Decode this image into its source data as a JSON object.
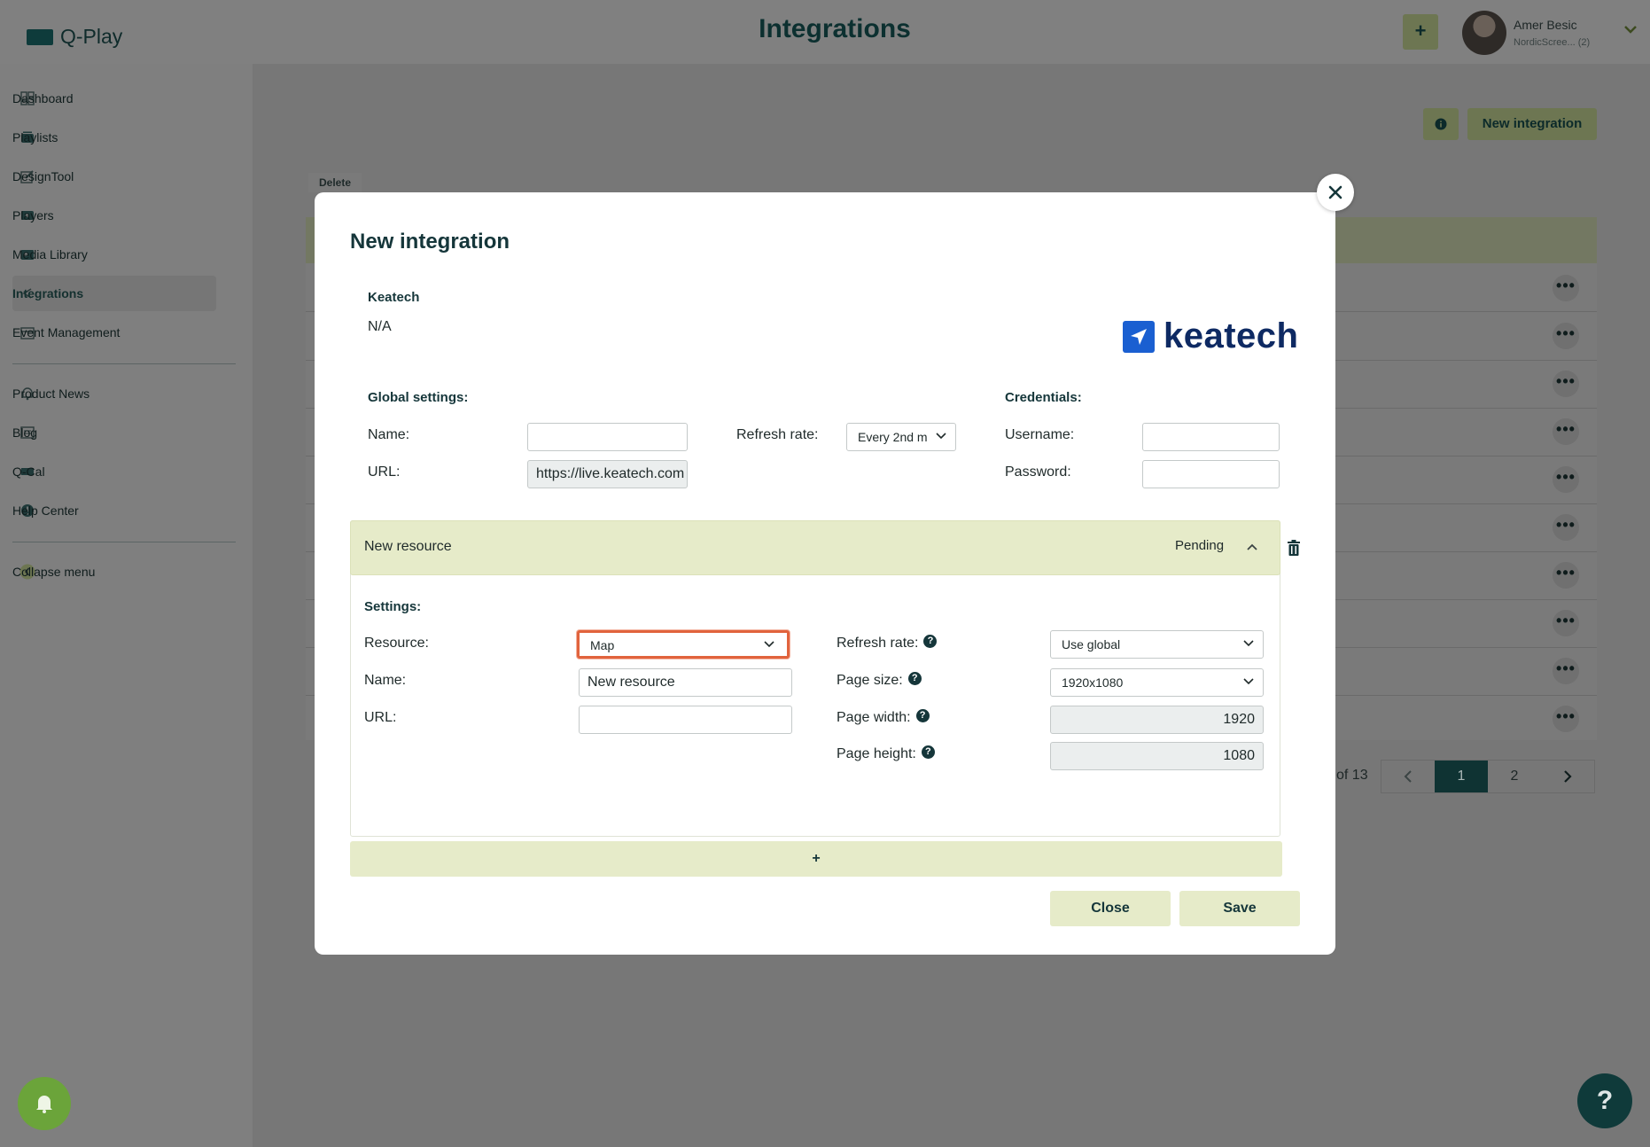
{
  "app": {
    "name": "Q-Play",
    "page_title": "Integrations",
    "top_add_label": "+",
    "user": {
      "name": "Amer Besic",
      "org": "NordicScree... (2)"
    }
  },
  "sidebar": {
    "items": [
      {
        "label": "Dashboard",
        "icon": "dashboard-icon"
      },
      {
        "label": "Playlists",
        "icon": "playlist-icon"
      },
      {
        "label": "DesignTool",
        "icon": "design-icon"
      },
      {
        "label": "Players",
        "icon": "player-icon"
      },
      {
        "label": "Media Library",
        "icon": "media-icon"
      },
      {
        "label": "Integrations",
        "icon": "integrations-icon",
        "active": true
      },
      {
        "label": "Event Management",
        "icon": "calendar-icon"
      }
    ],
    "secondary": [
      {
        "label": "Product News",
        "icon": "bell-icon"
      },
      {
        "label": "Blog",
        "icon": "blog-icon"
      },
      {
        "label": "Q-Cal",
        "icon": "qcal-icon"
      },
      {
        "label": "Help Center",
        "icon": "help-icon"
      }
    ],
    "collapse_label": "Collapse menu"
  },
  "page": {
    "new_integration_label": "New integration",
    "delete_label": "Delete",
    "pager": {
      "of_text": "of 13",
      "pages": [
        "1",
        "2"
      ],
      "current": "1"
    }
  },
  "modal": {
    "title": "New integration",
    "provider": {
      "name": "Keatech",
      "description": "N/A",
      "logo_text": "keatech"
    },
    "global": {
      "title": "Global settings:",
      "name_label": "Name:",
      "name_value": "",
      "url_label": "URL:",
      "url_value": "https://live.keatech.com",
      "refresh_label": "Refresh rate:",
      "refresh_value": "Every 2nd m"
    },
    "credentials": {
      "title": "Credentials:",
      "username_label": "Username:",
      "username_value": "",
      "password_label": "Password:",
      "password_value": ""
    },
    "resource": {
      "name": "New resource",
      "status": "Pending",
      "settings_title": "Settings:",
      "resource_label": "Resource:",
      "resource_value": "Map",
      "name_label": "Name:",
      "name_value": "New resource",
      "url_label": "URL:",
      "url_value": "",
      "refresh_label": "Refresh rate:",
      "refresh_value": "Use global",
      "page_size_label": "Page size:",
      "page_size_value": "1920x1080",
      "page_width_label": "Page width:",
      "page_width_value": "1920",
      "page_height_label": "Page height:",
      "page_height_value": "1080",
      "help_mark": "?"
    },
    "add_resource_label": "+",
    "close_label": "Close",
    "save_label": "Save"
  },
  "colors": {
    "brand_dark": "#15363a",
    "accent_light": "#e6ebc9",
    "focus_ring": "#e1633d",
    "keatech_blue": "#1a5fd1"
  }
}
